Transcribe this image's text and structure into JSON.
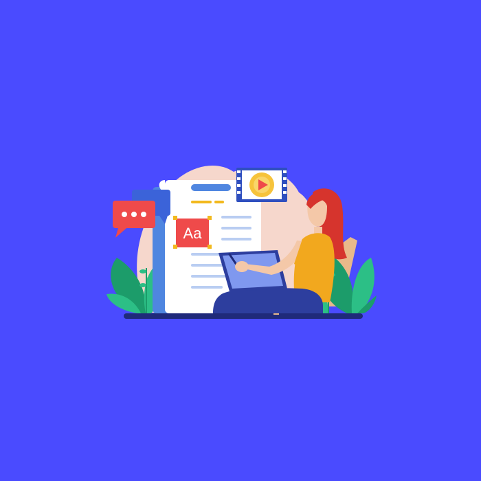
{
  "illustration": {
    "typeface_card": {
      "label": "Aa"
    },
    "colors": {
      "background": "#4a4bff",
      "blob": "#f6d7cc",
      "document": "#ffffff",
      "document_shadow": "#4f86e0",
      "text_line": "#b9cdf2",
      "heading_bar": "#4f86e0",
      "accent_line": "#f2b91e",
      "chat_red": "#ef4a4a",
      "chat_blue": "#3b63d9",
      "typeface_card_red": "#ef4a4a",
      "video_yellow": "#f6c33b",
      "video_frame": "#2f4fbf",
      "hair": "#d6342d",
      "shirt": "#f2a81e",
      "skin": "#f4c8a8",
      "pants": "#2d3e9e",
      "tablet": "#5f7be3",
      "leaf_dark": "#1c9c6a",
      "leaf_light": "#2cbf86",
      "ground": "#1f2a7a",
      "chair": "#e9b98a"
    }
  }
}
